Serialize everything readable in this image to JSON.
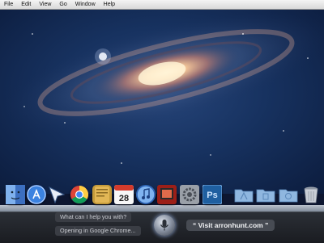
{
  "menubar": {
    "items": [
      "File",
      "Edit",
      "View",
      "Go",
      "Window",
      "Help"
    ]
  },
  "dock": {
    "icons": [
      {
        "name": "finder-icon",
        "color": "#4f8bd8"
      },
      {
        "name": "app-store-icon",
        "color": "#2f6fd0"
      },
      {
        "name": "cursor-arrow-icon",
        "color": "#e8eef7"
      },
      {
        "name": "chrome-icon",
        "color": "#dc4437"
      },
      {
        "name": "notepad-icon",
        "color": "#c49a3a"
      },
      {
        "name": "calendar-icon",
        "color": "#f5f5f5",
        "label": "28"
      },
      {
        "name": "itunes-icon",
        "color": "#3c7fd8"
      },
      {
        "name": "photo-booth-icon",
        "color": "#b3261e"
      },
      {
        "name": "system-preferences-icon",
        "color": "#8c8f95"
      },
      {
        "name": "photoshop-icon",
        "color": "#2a6fb3",
        "label": "Ps"
      },
      {
        "name": "applications-folder-icon",
        "color": "#8fb7e0"
      },
      {
        "name": "documents-folder-icon",
        "color": "#8fb7e0"
      },
      {
        "name": "downloads-folder-icon",
        "color": "#8fb7e0"
      },
      {
        "name": "trash-icon",
        "color": "#c9ced6"
      }
    ]
  },
  "siri": {
    "prompt": "What can I help you with?",
    "status": "Opening in Google Chrome...",
    "response": "“ Visit arronhunt.com ”"
  }
}
